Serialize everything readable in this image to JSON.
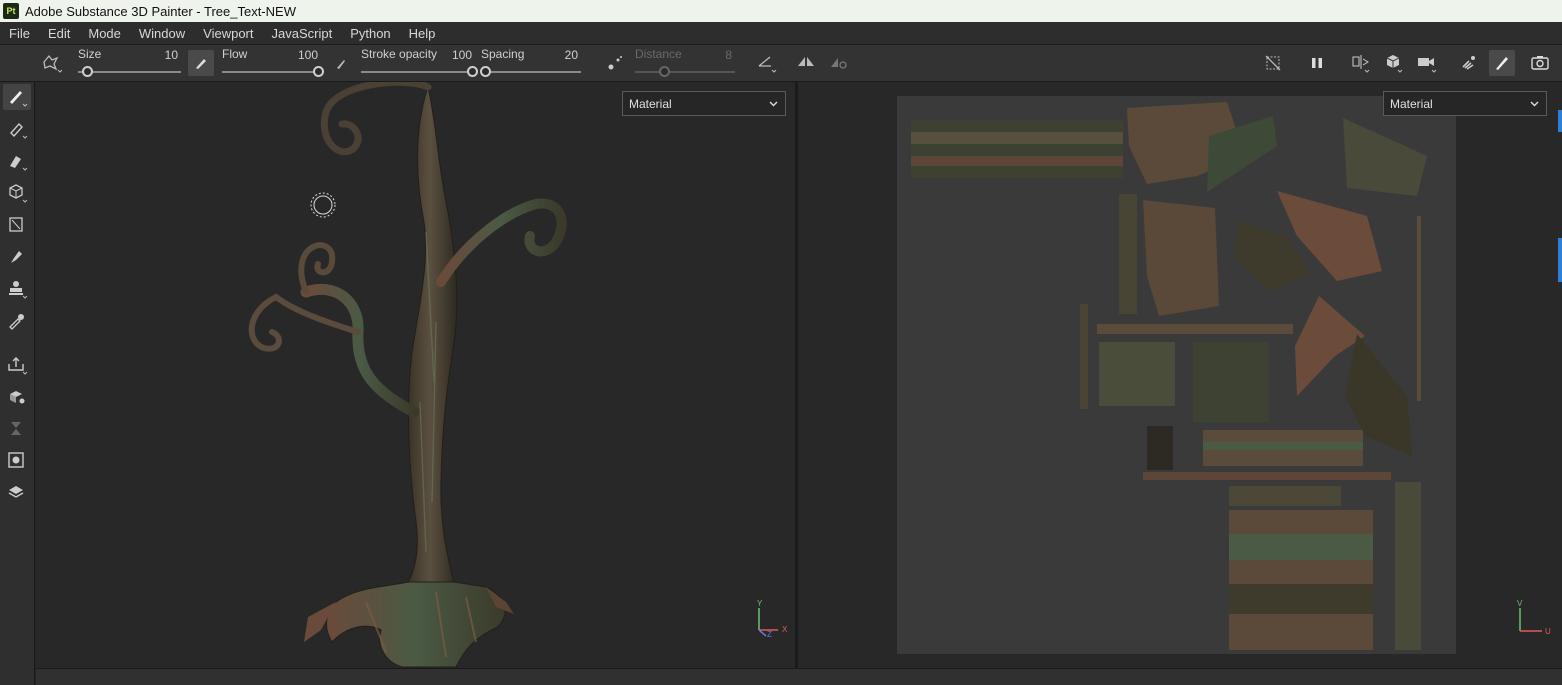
{
  "titlebar": {
    "logo": "Pt",
    "title": "Adobe Substance 3D Painter - Tree_Text-NEW"
  },
  "menu": [
    "File",
    "Edit",
    "Mode",
    "Window",
    "Viewport",
    "JavaScript",
    "Python",
    "Help"
  ],
  "toolbar": {
    "size": {
      "label": "Size",
      "value": "10",
      "level": 0.1
    },
    "flow": {
      "label": "Flow",
      "value": "100",
      "level": 1.0
    },
    "stroke_opacity": {
      "label": "Stroke opacity",
      "value": "100",
      "level": 1.0
    },
    "spacing": {
      "label": "Spacing",
      "value": "20",
      "level": 0.05
    },
    "distance": {
      "label": "Distance",
      "value": "8",
      "level": 0.3,
      "disabled": true
    }
  },
  "viewport3d": {
    "channel": "Material",
    "axes": {
      "y": "Y",
      "x": "X",
      "z": "Z"
    }
  },
  "viewport2d": {
    "channel": "Material",
    "axes": {
      "v": "V",
      "u": "U"
    }
  },
  "colors": {
    "accent": "#2f7fd6",
    "bark_dark": "#3e3a2c",
    "bark_red": "#6b4a3a",
    "bark_green": "#4a5a44"
  },
  "icons": {
    "left_tools": [
      "paint-brush-icon",
      "eraser-icon",
      "projection-icon",
      "geometry-fill-icon",
      "smudge-icon",
      "clone-icon",
      "stamp-icon",
      "color-picker-icon",
      "export-icon",
      "bake-icon",
      "history-icon",
      "display-settings-icon",
      "shelf-icon"
    ],
    "right_tools": [
      "hide-uv-icon",
      "pause-icon",
      "split-view-icon",
      "3d-view-icon",
      "camera-icon",
      "explode-icon",
      "paint-mode-icon",
      "screenshot-icon"
    ]
  }
}
